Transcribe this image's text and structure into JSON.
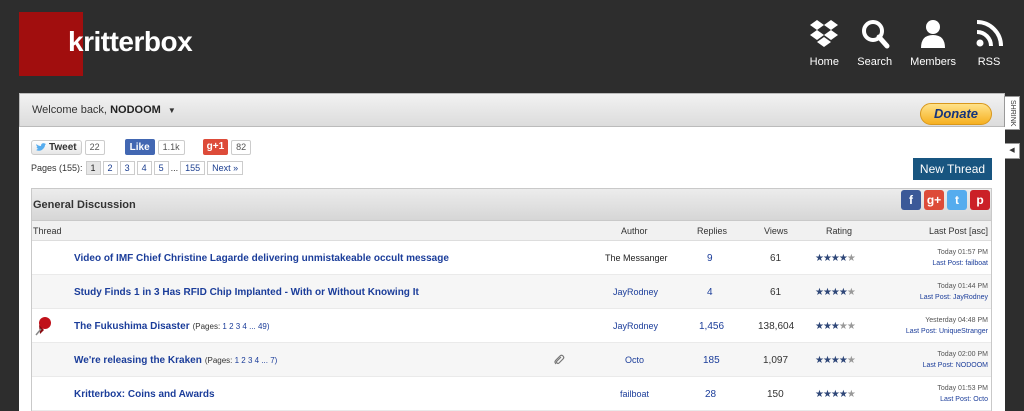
{
  "brand": {
    "name": "kritterbox",
    "logo_color": "#a10e0e"
  },
  "nav": [
    {
      "label": "Home",
      "icon": "dropbox-icon"
    },
    {
      "label": "Search",
      "icon": "search-icon"
    },
    {
      "label": "Members",
      "icon": "user-icon"
    },
    {
      "label": "RSS",
      "icon": "rss-icon"
    }
  ],
  "welcome": {
    "prefix": "Welcome back,",
    "username": "NODOOM",
    "caret": "▼"
  },
  "donate": {
    "label": "Donate"
  },
  "side_tab": {
    "label": "SHRINK",
    "arrow": "◀"
  },
  "social": {
    "tweet_label": "Tweet",
    "tweet_count": "22",
    "like_label": "Like",
    "like_count": "1.1k",
    "gplus_label": "g+1",
    "gplus_count": "82"
  },
  "pagination": {
    "label": "Pages (155):",
    "pages": [
      "1",
      "2",
      "3",
      "4",
      "5"
    ],
    "ellipsis": "...",
    "last": "155",
    "next": "Next »"
  },
  "new_thread": {
    "label": "New Thread"
  },
  "forum": {
    "title": "General Discussion",
    "columns": {
      "thread": "Thread",
      "author": "Author",
      "replies": "Replies",
      "views": "Views",
      "rating": "Rating",
      "last_post": "Last Post [asc]"
    },
    "threads": [
      {
        "title": "Video of IMF Chief Christine Lagarde delivering unmistakeable occult message",
        "pages": "",
        "author": "The Messanger",
        "replies": "9",
        "views": "61",
        "rating": 4,
        "last_time": "Today 01:57 PM",
        "last_prefix": "Last Post:",
        "last_user": "failboat"
      },
      {
        "title": "Study Finds 1 in 3 Has RFID Chip Implanted - With or Without Knowing It",
        "pages": "",
        "author": "JayRodney",
        "replies": "4",
        "views": "61",
        "rating": 4,
        "last_time": "Today 01:44 PM",
        "last_prefix": "Last Post:",
        "last_user": "JayRodney"
      },
      {
        "title": "The Fukushima Disaster",
        "pages_prefix": "(Pages:",
        "pages": "1 2 3 4 ... 49)",
        "author": "JayRodney",
        "replies": "1,456",
        "views": "138,604",
        "rating": 3,
        "last_time": "Yesterday 04:48 PM",
        "last_prefix": "Last Post:",
        "last_user": "UniqueStranger"
      },
      {
        "title": "We're releasing the Kraken",
        "pages_prefix": "(Pages:",
        "pages": "1 2 3 4 ... 7)",
        "author": "Octo",
        "replies": "185",
        "views": "1,097",
        "rating": 4,
        "last_time": "Today 02:00 PM",
        "last_prefix": "Last Post:",
        "last_user": "NODOOM"
      },
      {
        "title": "Kritterbox: Coins and Awards",
        "pages": "",
        "author": "failboat",
        "replies": "28",
        "views": "150",
        "rating": 4,
        "last_time": "Today 01:53 PM",
        "last_prefix": "Last Post:",
        "last_user": "Octo"
      }
    ]
  },
  "share_icons": [
    {
      "icon": "facebook-icon",
      "glyph": "f",
      "color": "#3b5998"
    },
    {
      "icon": "google-plus-icon",
      "glyph": "g+",
      "color": "#dd4b39"
    },
    {
      "icon": "twitter-icon",
      "glyph": "t",
      "color": "#55acee"
    },
    {
      "icon": "pinterest-icon",
      "glyph": "p",
      "color": "#cb2027"
    }
  ]
}
